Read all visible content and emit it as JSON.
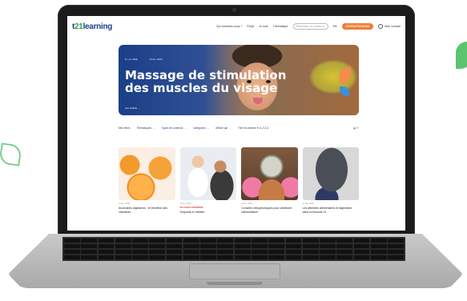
{
  "site": {
    "logo_prefix": "t",
    "logo_num": "21",
    "logo_suffix": "learning"
  },
  "nav": {
    "links": [
      "Qui sommes-nous ?",
      "FAQs",
      "Je suis",
      "Thématique"
    ],
    "search_placeholder": "Rechercher un contenu",
    "lang": "EN",
    "cta": "CONTACTEZ-NOUS",
    "account": "Mon compte"
  },
  "hero": {
    "kicker": "À LA UNE",
    "date": "13 fév. 2023",
    "title": "Massage de stimulation des muscles du visage",
    "link": "Lire l'article →"
  },
  "filters": {
    "label": "Mes filtres",
    "items": [
      "Thématiques",
      "Types de contenus",
      "Catégories",
      "Affiché par"
    ],
    "sort": "Trier les articles ▼  A-Z  Z-A",
    "view": "▦ ☰"
  },
  "cards": [
    {
      "meta": "13 fév. 2023",
      "tag": "",
      "title": "Anomalies digestives : le bénéfice des vitamines"
    },
    {
      "meta": "13 fév. 2023",
      "tag": "EN AVANT-PREMIÈRE",
      "title": "Surpoids et obésité :"
    },
    {
      "meta": "13 fév. 2023",
      "tag": "",
      "title": "Conseils orthophoniques pour améliorer l'alimentation"
    },
    {
      "meta": "13 fév. 2023",
      "tag": "",
      "title": "Les atteintes alimentaires et digestives dans la trisomie 21"
    }
  ]
}
